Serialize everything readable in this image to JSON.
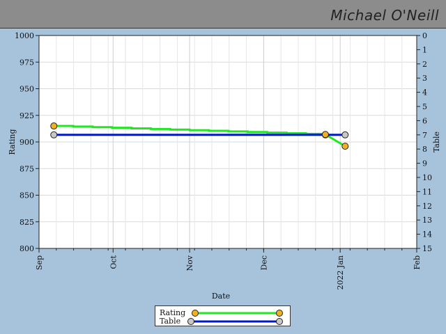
{
  "header": {
    "player_name": "Michael O'Neill"
  },
  "chart_data": {
    "type": "line",
    "title": "",
    "xlabel": "Date",
    "ylabel_left": "Rating",
    "ylabel_right": "Table",
    "x_ticks": [
      {
        "date": "2021-09-01",
        "label": "Sep"
      },
      {
        "date": "2021-10-01",
        "label": "Oct"
      },
      {
        "date": "2021-11-01",
        "label": "Nov"
      },
      {
        "date": "2021-12-01",
        "label": "Dec"
      },
      {
        "date": "2022-01-01",
        "label": "2022 Jan"
      },
      {
        "date": "2022-02-01",
        "label": "Feb"
      }
    ],
    "xlim": [
      "2021-09-01",
      "2022-02-01"
    ],
    "y_left": {
      "min": 800,
      "max": 1000,
      "ticks": [
        800,
        825,
        850,
        875,
        900,
        925,
        950,
        975,
        1000
      ]
    },
    "y_right": {
      "min": 0,
      "max": 15,
      "inverted": true,
      "ticks": [
        0,
        1,
        2,
        3,
        4,
        5,
        6,
        7,
        8,
        9,
        10,
        11,
        12,
        13,
        14,
        15
      ]
    },
    "grid": true,
    "series": [
      {
        "name": "Rating",
        "axis": "left",
        "color": "#22e622",
        "marker_color": "#f0b020",
        "points": [
          {
            "x": "2021-09-07",
            "y": 915
          },
          {
            "x": "2021-12-26",
            "y": 907
          },
          {
            "x": "2022-01-03",
            "y": 896
          }
        ]
      },
      {
        "name": "Table",
        "axis": "right",
        "color": "#0018c8",
        "marker_color": "#c8c8c8",
        "points": [
          {
            "x": "2021-09-07",
            "y": 7
          },
          {
            "x": "2021-12-26",
            "y": 7
          },
          {
            "x": "2022-01-03",
            "y": 7
          }
        ]
      }
    ],
    "legend": {
      "position": "bottom-center",
      "entries": [
        "Rating",
        "Table"
      ]
    }
  }
}
